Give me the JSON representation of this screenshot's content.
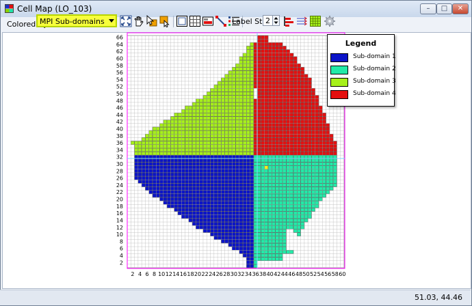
{
  "window": {
    "title": "Cell Map (LO_103)",
    "minimize_glyph": "–",
    "maximize_glyph": "□",
    "close_glyph": "✕"
  },
  "toolbar": {
    "colored_by_label": "Colored By:",
    "colored_by_value": "MPI Sub-domains",
    "label_step_label": "Label Step:",
    "label_step_value": "2",
    "icons": [
      "zoom-extents-icon",
      "pan-hand-icon",
      "select-pointer-icon",
      "query-cell-icon",
      "grid-box-icon",
      "grid-lines-icon",
      "layer-icon",
      "connect-line-icon",
      "list-icon",
      "boundary-bars-icon",
      "flow-arrows-icon",
      "grid-fill-icon",
      "settings-gear-icon"
    ]
  },
  "map": {
    "y_tick_labels": [
      "66",
      "64",
      "62",
      "60",
      "58",
      "56",
      "54",
      "52",
      "50",
      "48",
      "46",
      "44",
      "42",
      "40",
      "38",
      "36",
      "34",
      "32",
      "30",
      "28",
      "26",
      "24",
      "22",
      "20",
      "18",
      "16",
      "14",
      "12",
      "10",
      "8",
      "6",
      "4",
      "2"
    ],
    "x_tick_labels": [
      "2",
      "4",
      "6",
      "8",
      "10",
      "12",
      "14",
      "16",
      "18",
      "20",
      "22",
      "24",
      "26",
      "28",
      "30",
      "32",
      "34",
      "36",
      "38",
      "40",
      "42",
      "44",
      "46",
      "48",
      "50",
      "52",
      "54",
      "56",
      "58",
      "60"
    ],
    "columns": 60,
    "rows": 66,
    "colors": {
      "sub1": "#0b14c8",
      "sub2": "#22eaa8",
      "sub3": "#a6f01a",
      "sub4": "#e31010",
      "highlight": "#f5ef1a",
      "boundary": "#ff00ff",
      "grid": "#b8b8b8"
    }
  },
  "legend": {
    "title": "Legend",
    "items": [
      {
        "label": "Sub-domain 1",
        "color": "#0b14c8"
      },
      {
        "label": "Sub-domain 2",
        "color": "#22eaa8"
      },
      {
        "label": "Sub-domain 3",
        "color": "#a6f01a"
      },
      {
        "label": "Sub-domain 4",
        "color": "#e31010"
      }
    ]
  },
  "status": {
    "coords": "51.03, 44.46"
  }
}
